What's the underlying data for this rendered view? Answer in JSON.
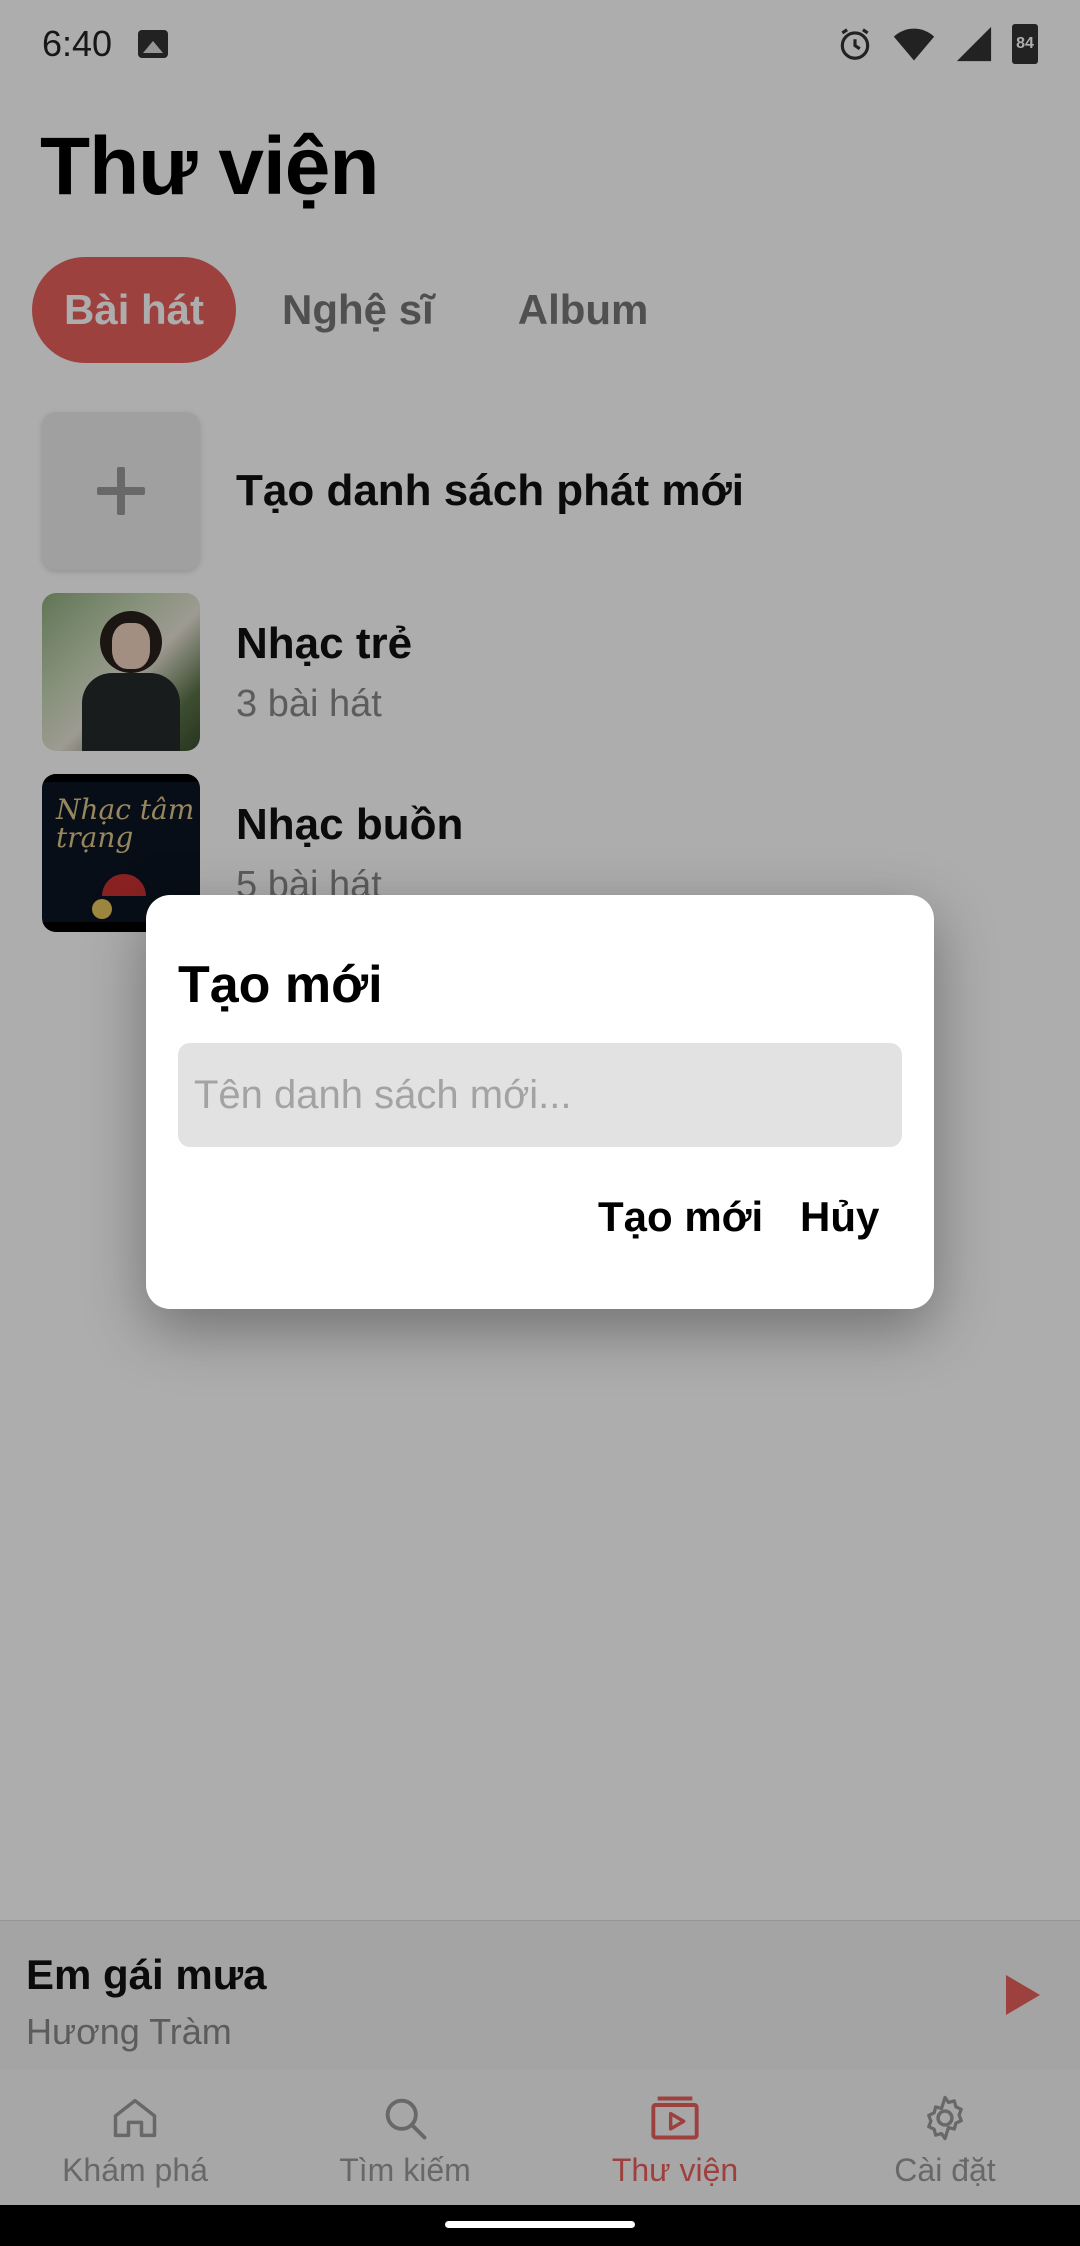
{
  "status_bar": {
    "time": "6:40",
    "icons": [
      "image-icon",
      "alarm-icon",
      "wifi-icon",
      "signal-icon",
      "battery-icon"
    ],
    "battery": "84"
  },
  "header": {
    "title": "Thư viện"
  },
  "tabs": [
    {
      "label": "Bài hát",
      "active": true
    },
    {
      "label": "Nghệ sĩ",
      "active": false
    },
    {
      "label": "Album",
      "active": false
    }
  ],
  "playlists": {
    "create_label": "Tạo danh sách phát mới",
    "items": [
      {
        "title": "Nhạc trẻ",
        "subtitle": "3 bài hát"
      },
      {
        "title": "Nhạc buồn",
        "subtitle": "5 bài hát"
      }
    ],
    "cover_text": "Nhạc tâm trạng"
  },
  "mini_player": {
    "title": "Em gái mưa",
    "artist": "Hương Tràm",
    "accent": "#e8615d"
  },
  "bottom_nav": [
    {
      "label": "Khám phá",
      "icon": "home-icon",
      "active": false
    },
    {
      "label": "Tìm kiếm",
      "icon": "search-icon",
      "active": false
    },
    {
      "label": "Thư viện",
      "icon": "library-icon",
      "active": true
    },
    {
      "label": "Cài đặt",
      "icon": "gear-icon",
      "active": false
    }
  ],
  "dialog": {
    "title": "Tạo mới",
    "input_placeholder": "Tên danh sách mới...",
    "input_value": "",
    "create_label": "Tạo mới",
    "cancel_label": "Hủy"
  },
  "colors": {
    "accent": "#e8615d",
    "scrim": "rgba(0,0,0,0.32)"
  }
}
